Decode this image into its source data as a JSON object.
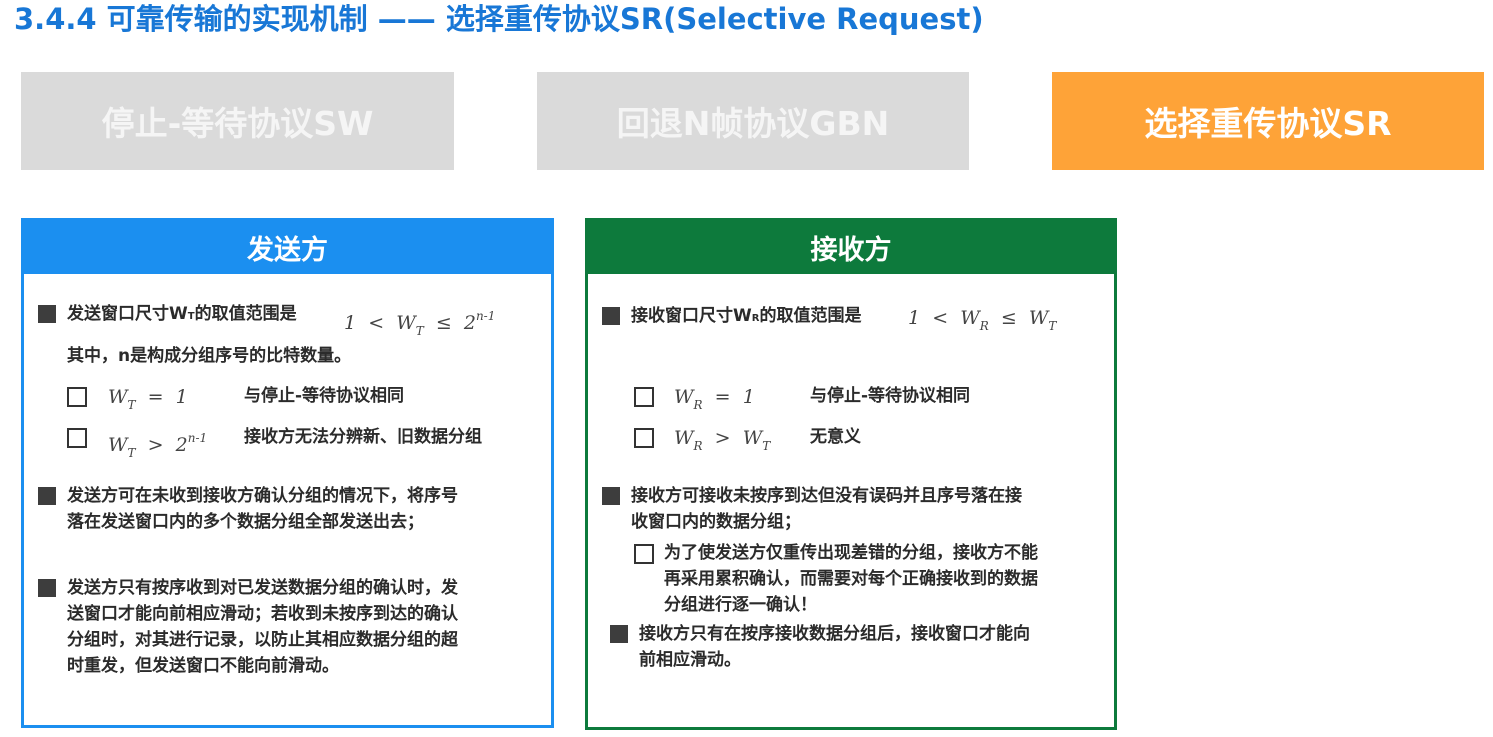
{
  "header": {
    "title": "3.4.4 可靠传输的实现机制 —— 选择重传协议SR(Selective Request)"
  },
  "tabs": [
    {
      "label": "停止-等待协议SW",
      "active": false
    },
    {
      "label": "回退N帧协议GBN",
      "active": false
    },
    {
      "label": "选择重传协议SR",
      "active": true
    }
  ],
  "colors": {
    "title_blue": "#1877d6",
    "tab_inactive": "#dadada",
    "tab_active": "#fea338",
    "sender_blue": "#1b8ff0",
    "receiver_green": "#0d7a3c"
  },
  "sender": {
    "title": "发送方",
    "bullet1": {
      "text": "发送窗口尺寸W",
      "sub": "T",
      "text_tail": "的取值范围是",
      "formula": {
        "left": "1",
        "op1": "<",
        "var": "W",
        "sub": "T",
        "op2": "≤",
        "base": "2",
        "exp": "n-1"
      },
      "note": "其中，n是构成分组序号的比特数量。",
      "cases": [
        {
          "formula": {
            "var": "W",
            "sub": "T",
            "op": "=",
            "rhs": "1"
          },
          "text": "与停止-等待协议相同"
        },
        {
          "formula": {
            "var": "W",
            "sub": "T",
            "op": ">",
            "base": "2",
            "exp": "n-1"
          },
          "text": "接收方无法分辨新、旧数据分组"
        }
      ]
    },
    "bullet2": {
      "line1": "发送方可在未收到接收方确认分组的情况下，将序号",
      "line2": "落在发送窗口内的多个数据分组全部发送出去；"
    },
    "bullet3": {
      "line1": "发送方只有按序收到对已发送数据分组的确认时，发",
      "line2": "送窗口才能向前相应滑动；若收到未按序到达的确认",
      "line3": "分组时，对其进行记录，以防止其相应数据分组的超",
      "line4": "时重发，但发送窗口不能向前滑动。"
    }
  },
  "receiver": {
    "title": "接收方",
    "bullet1": {
      "text": "接收窗口尺寸W",
      "sub": "R",
      "text_tail": "的取值范围是",
      "formula": {
        "left": "1",
        "op1": "<",
        "var": "W",
        "sub": "R",
        "op2": "≤",
        "rhs_var": "W",
        "rhs_sub": "T"
      },
      "cases": [
        {
          "formula": {
            "var": "W",
            "sub": "R",
            "op": "=",
            "rhs": "1"
          },
          "text": "与停止-等待协议相同"
        },
        {
          "formula": {
            "var": "W",
            "sub": "R",
            "op": ">",
            "rhs_var": "W",
            "rhs_sub": "T"
          },
          "text": "无意义"
        }
      ]
    },
    "bullet2": {
      "line1": "接收方可接收未按序到达但没有误码并且序号落在接",
      "line2": "收窗口内的数据分组；",
      "sub": {
        "line1": "为了使发送方仅重传出现差错的分组，接收方不能",
        "line2": "再采用累积确认，而需要对每个正确接收到的数据",
        "line3": "分组进行逐一确认！"
      }
    },
    "bullet3": {
      "line1": "接收方只有在按序接收数据分组后，接收窗口才能向",
      "line2": "前相应滑动。"
    }
  }
}
